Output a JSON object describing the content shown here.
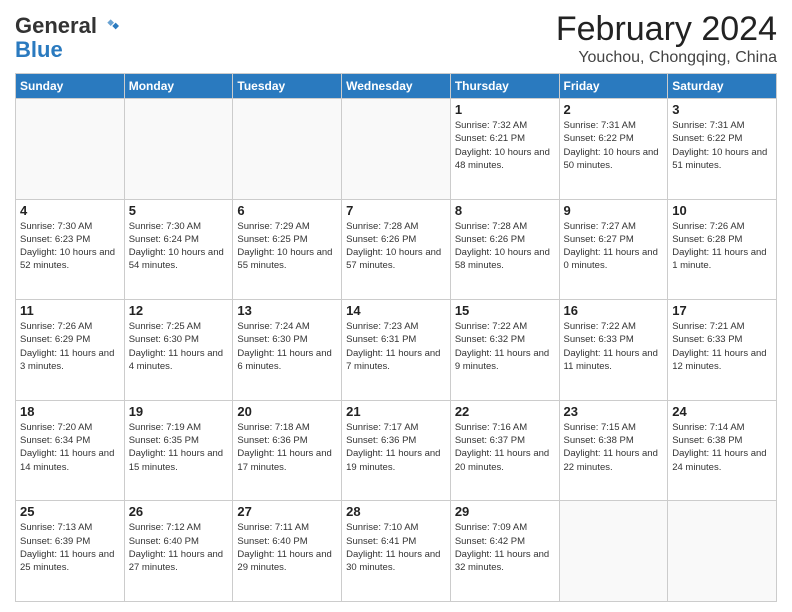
{
  "header": {
    "logo_general": "General",
    "logo_blue": "Blue",
    "title": "February 2024",
    "subtitle": "Youchou, Chongqing, China"
  },
  "weekdays": [
    "Sunday",
    "Monday",
    "Tuesday",
    "Wednesday",
    "Thursday",
    "Friday",
    "Saturday"
  ],
  "weeks": [
    [
      {
        "day": "",
        "info": ""
      },
      {
        "day": "",
        "info": ""
      },
      {
        "day": "",
        "info": ""
      },
      {
        "day": "",
        "info": ""
      },
      {
        "day": "1",
        "info": "Sunrise: 7:32 AM\nSunset: 6:21 PM\nDaylight: 10 hours and 48 minutes."
      },
      {
        "day": "2",
        "info": "Sunrise: 7:31 AM\nSunset: 6:22 PM\nDaylight: 10 hours and 50 minutes."
      },
      {
        "day": "3",
        "info": "Sunrise: 7:31 AM\nSunset: 6:22 PM\nDaylight: 10 hours and 51 minutes."
      }
    ],
    [
      {
        "day": "4",
        "info": "Sunrise: 7:30 AM\nSunset: 6:23 PM\nDaylight: 10 hours and 52 minutes."
      },
      {
        "day": "5",
        "info": "Sunrise: 7:30 AM\nSunset: 6:24 PM\nDaylight: 10 hours and 54 minutes."
      },
      {
        "day": "6",
        "info": "Sunrise: 7:29 AM\nSunset: 6:25 PM\nDaylight: 10 hours and 55 minutes."
      },
      {
        "day": "7",
        "info": "Sunrise: 7:28 AM\nSunset: 6:26 PM\nDaylight: 10 hours and 57 minutes."
      },
      {
        "day": "8",
        "info": "Sunrise: 7:28 AM\nSunset: 6:26 PM\nDaylight: 10 hours and 58 minutes."
      },
      {
        "day": "9",
        "info": "Sunrise: 7:27 AM\nSunset: 6:27 PM\nDaylight: 11 hours and 0 minutes."
      },
      {
        "day": "10",
        "info": "Sunrise: 7:26 AM\nSunset: 6:28 PM\nDaylight: 11 hours and 1 minute."
      }
    ],
    [
      {
        "day": "11",
        "info": "Sunrise: 7:26 AM\nSunset: 6:29 PM\nDaylight: 11 hours and 3 minutes."
      },
      {
        "day": "12",
        "info": "Sunrise: 7:25 AM\nSunset: 6:30 PM\nDaylight: 11 hours and 4 minutes."
      },
      {
        "day": "13",
        "info": "Sunrise: 7:24 AM\nSunset: 6:30 PM\nDaylight: 11 hours and 6 minutes."
      },
      {
        "day": "14",
        "info": "Sunrise: 7:23 AM\nSunset: 6:31 PM\nDaylight: 11 hours and 7 minutes."
      },
      {
        "day": "15",
        "info": "Sunrise: 7:22 AM\nSunset: 6:32 PM\nDaylight: 11 hours and 9 minutes."
      },
      {
        "day": "16",
        "info": "Sunrise: 7:22 AM\nSunset: 6:33 PM\nDaylight: 11 hours and 11 minutes."
      },
      {
        "day": "17",
        "info": "Sunrise: 7:21 AM\nSunset: 6:33 PM\nDaylight: 11 hours and 12 minutes."
      }
    ],
    [
      {
        "day": "18",
        "info": "Sunrise: 7:20 AM\nSunset: 6:34 PM\nDaylight: 11 hours and 14 minutes."
      },
      {
        "day": "19",
        "info": "Sunrise: 7:19 AM\nSunset: 6:35 PM\nDaylight: 11 hours and 15 minutes."
      },
      {
        "day": "20",
        "info": "Sunrise: 7:18 AM\nSunset: 6:36 PM\nDaylight: 11 hours and 17 minutes."
      },
      {
        "day": "21",
        "info": "Sunrise: 7:17 AM\nSunset: 6:36 PM\nDaylight: 11 hours and 19 minutes."
      },
      {
        "day": "22",
        "info": "Sunrise: 7:16 AM\nSunset: 6:37 PM\nDaylight: 11 hours and 20 minutes."
      },
      {
        "day": "23",
        "info": "Sunrise: 7:15 AM\nSunset: 6:38 PM\nDaylight: 11 hours and 22 minutes."
      },
      {
        "day": "24",
        "info": "Sunrise: 7:14 AM\nSunset: 6:38 PM\nDaylight: 11 hours and 24 minutes."
      }
    ],
    [
      {
        "day": "25",
        "info": "Sunrise: 7:13 AM\nSunset: 6:39 PM\nDaylight: 11 hours and 25 minutes."
      },
      {
        "day": "26",
        "info": "Sunrise: 7:12 AM\nSunset: 6:40 PM\nDaylight: 11 hours and 27 minutes."
      },
      {
        "day": "27",
        "info": "Sunrise: 7:11 AM\nSunset: 6:40 PM\nDaylight: 11 hours and 29 minutes."
      },
      {
        "day": "28",
        "info": "Sunrise: 7:10 AM\nSunset: 6:41 PM\nDaylight: 11 hours and 30 minutes."
      },
      {
        "day": "29",
        "info": "Sunrise: 7:09 AM\nSunset: 6:42 PM\nDaylight: 11 hours and 32 minutes."
      },
      {
        "day": "",
        "info": ""
      },
      {
        "day": "",
        "info": ""
      }
    ]
  ]
}
